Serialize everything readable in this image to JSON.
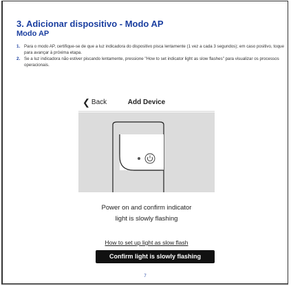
{
  "document": {
    "section_title": "3. Adicionar dispositivo - Modo AP",
    "subtitle": "Modo AP",
    "steps": [
      {
        "number": "1.",
        "text": "Para o modo AP, certifique-se de que a luz indicadora do dispositivo pisca lentamente (1 vez a cada 3 segundos); em caso positivo, toque para avançar à próxima etapa."
      },
      {
        "number": "2.",
        "text": "Se a luz indicadora não estiver piscando lentamente, pressione \"How to set indicator light as slow flashes\" para visualizar os processos operacionais."
      }
    ],
    "page_number": "7"
  },
  "app_screen": {
    "back_label": "Back",
    "title": "Add Device",
    "prompt_line1": "Power on and confirm indicator",
    "prompt_line2": "light is slowly flashing",
    "help_link": "How to set up light as slow flash",
    "confirm_button": "Confirm light is slowly flashing"
  },
  "icons": {
    "back": "chevron-left-icon",
    "power": "power-icon",
    "device": "device-outline-illustration"
  },
  "colors": {
    "heading": "#1b3fa0",
    "illustration_bg": "#dcdcdc",
    "button_bg": "#111111"
  }
}
